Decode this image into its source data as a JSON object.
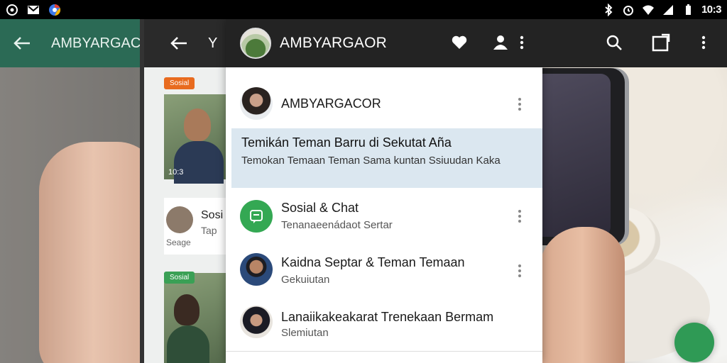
{
  "status_bar": {
    "time": "10:3",
    "left_icons": [
      "notification-icon",
      "gmail-icon",
      "chrome-icon"
    ],
    "right_icons": [
      "bluetooth-icon",
      "alarm-icon",
      "wifi-icon",
      "signal-icon",
      "battery-icon"
    ]
  },
  "left_app": {
    "title": "AMBYARGACO"
  },
  "middle_app": {
    "title": "Y",
    "pill_top": "Sosial",
    "row_title": "Sosi",
    "row_sub": "Tap",
    "row_caption": "Seage",
    "pill_bottom": "Sosial",
    "photo_caption": "10:3"
  },
  "main_header": {
    "title": "AMBYARGAOR",
    "icons": [
      "heart-icon",
      "person-icon",
      "more-vert-icon",
      "search-icon",
      "share-box-icon",
      "more-vert-icon"
    ]
  },
  "list": {
    "row1": {
      "name": "AMBYARGACOR"
    },
    "highlight": {
      "title": "Temikán Teman Barru di Sekutat Aña",
      "body": "Temokan Temaan Teman Sama kuntan Ssiuudan Kaka"
    },
    "row2": {
      "name": "Sosial & Chat",
      "sub": "Tenanaeenádaot Sertar"
    },
    "row3": {
      "name": "Kaidna Septar & Teman Temaan",
      "sub": "Gekuiutan"
    },
    "row4": {
      "name": "Lanaiikakeakarat Trenekaan Bermam",
      "sub": "Slemiutan"
    }
  },
  "colors": {
    "left_bar": "#2b6a55",
    "top_bar": "#232323",
    "highlight": "#dbe7f0",
    "green_accent": "#34a853",
    "fab": "#2f9a55"
  }
}
